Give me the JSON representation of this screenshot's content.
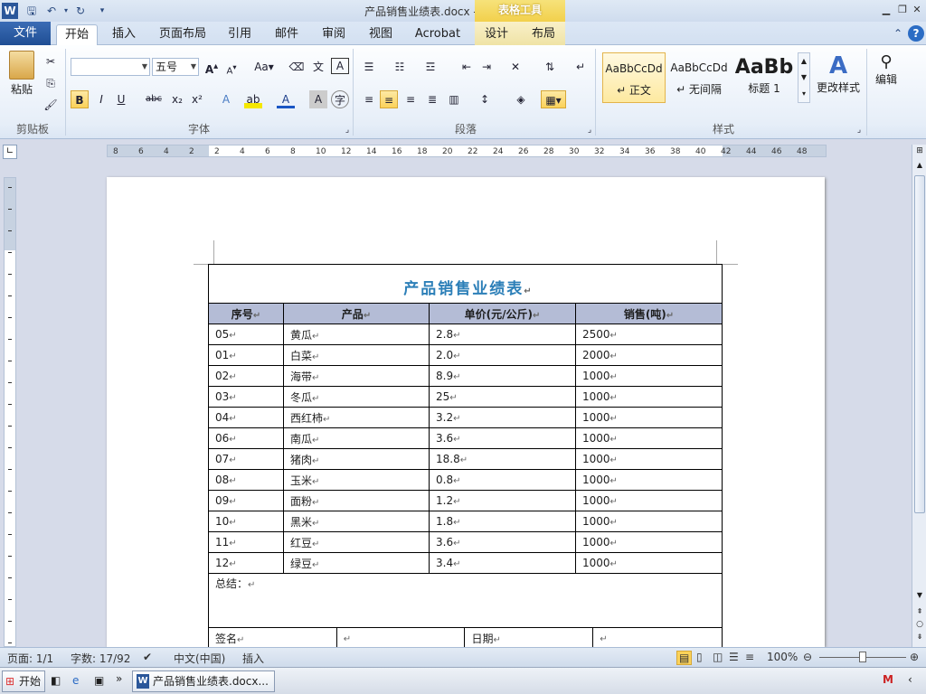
{
  "window": {
    "title": "产品销售业绩表.docx - Microsoft Word",
    "context_tab_group": "表格工具"
  },
  "tabs": [
    "文件",
    "开始",
    "插入",
    "页面布局",
    "引用",
    "邮件",
    "审阅",
    "视图",
    "Acrobat",
    "设计",
    "布局"
  ],
  "ribbon": {
    "clipboard": {
      "paste": "粘贴",
      "group": "剪贴板"
    },
    "font": {
      "font_name": "",
      "font_size": "五号",
      "group": "字体"
    },
    "paragraph": {
      "group": "段落"
    },
    "styles": {
      "group": "样式",
      "items": [
        {
          "sample": "AaBbCcDd",
          "name": "↵ 正文"
        },
        {
          "sample": "AaBbCcDd",
          "name": "↵ 无间隔"
        },
        {
          "sample": "AaBb",
          "name": "标题 1"
        }
      ],
      "change_styles": "更改样式"
    },
    "editing": {
      "label": "编辑"
    }
  },
  "ruler": {
    "numbers": [
      "8",
      "6",
      "4",
      "2",
      "2",
      "4",
      "6",
      "8",
      "10",
      "12",
      "14",
      "16",
      "18",
      "20",
      "22",
      "24",
      "26",
      "28",
      "30",
      "32",
      "34",
      "36",
      "38",
      "40",
      "42",
      "44",
      "46",
      "48"
    ]
  },
  "document": {
    "table_title": "产品销售业绩表",
    "headers": [
      "序号",
      "产品",
      "单价(元/公斤)",
      "销售(吨)"
    ],
    "rows": [
      [
        "05",
        "黄瓜",
        "2.8",
        "2500"
      ],
      [
        "01",
        "白菜",
        "2.0",
        "2000"
      ],
      [
        "02",
        "海带",
        "8.9",
        "1000"
      ],
      [
        "03",
        "冬瓜",
        "25",
        "1000"
      ],
      [
        "04",
        "西红柿",
        "3.2",
        "1000"
      ],
      [
        "06",
        "南瓜",
        "3.6",
        "1000"
      ],
      [
        "07",
        "猪肉",
        "18.8",
        "1000"
      ],
      [
        "08",
        "玉米",
        "0.8",
        "1000"
      ],
      [
        "09",
        "面粉",
        "1.2",
        "1000"
      ],
      [
        "10",
        "黑米",
        "1.8",
        "1000"
      ],
      [
        "11",
        "红豆",
        "3.6",
        "1000"
      ],
      [
        "12",
        "绿豆",
        "3.4",
        "1000"
      ]
    ],
    "summary_label": "总结：",
    "sign_label": "签名",
    "date_label": "日期"
  },
  "statusbar": {
    "page": "页面: 1/1",
    "words": "字数: 17/92",
    "language": "中文(中国)",
    "mode": "插入",
    "zoom": "100%"
  },
  "taskbar": {
    "start": "开始",
    "task": "产品销售业绩表.docx..."
  }
}
